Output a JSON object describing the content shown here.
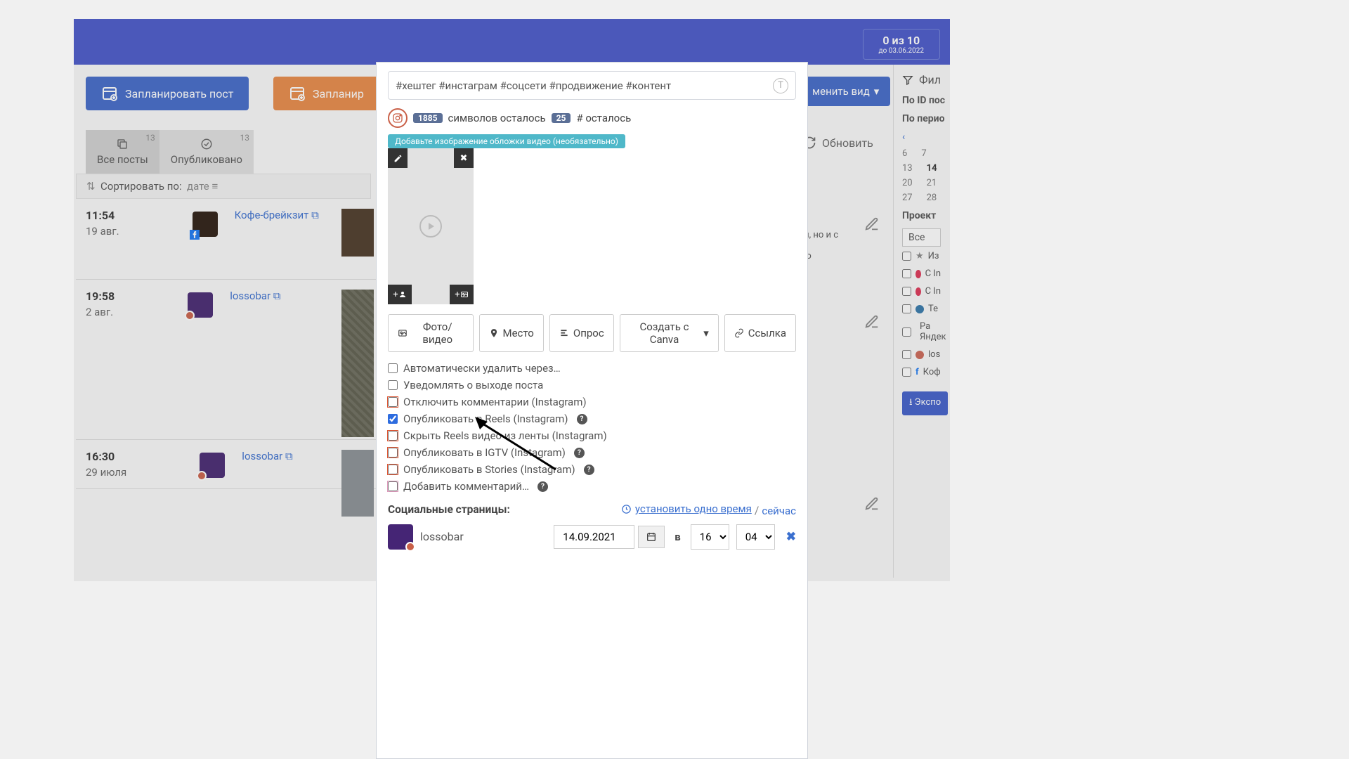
{
  "topbar": {
    "count_text": "0 из 10",
    "until_text": "до 03.06.2022"
  },
  "buttons": {
    "schedule_post": "Запланировать пост",
    "schedule_story": "Запланир",
    "change_view": "менить вид",
    "refresh": "Обновить"
  },
  "tabs": {
    "all_posts": "Все посты",
    "all_count": "13",
    "published": "Опубликовано",
    "published_count": "13"
  },
  "sort": {
    "label": "Сортировать по:",
    "value": "дате"
  },
  "posts": [
    {
      "time": "11:54",
      "date": "19 авг.",
      "title": "Кофе-брейкзит",
      "network": "fb",
      "preview": "м, но и с\n\nго"
    },
    {
      "time": "19:58",
      "date": "2 авг.",
      "title": "lossobar",
      "network": "ig"
    },
    {
      "time": "16:30",
      "date": "29 июля",
      "title": "lossobar",
      "network": "ig"
    }
  ],
  "sidebar": {
    "filter_title": "Фил",
    "by_id": "По ID пос",
    "by_period": "По перио",
    "project": "Проект",
    "all": "Все",
    "items": [
      "Из",
      "С In",
      "С In",
      "Те",
      "Ра\nЯндек",
      "los",
      "Коф"
    ],
    "export": "Экспо",
    "cal": [
      [
        "6",
        "7"
      ],
      [
        "13",
        "14"
      ],
      [
        "20",
        "21"
      ],
      [
        "27",
        "28"
      ]
    ]
  },
  "modal": {
    "composer_text": "#хештег #инстаграм #соцсети #продвижение #контент",
    "chars_remaining_label": "символов осталось",
    "chars_count": "1885",
    "hash_count": "25",
    "hash_label": "# осталось",
    "cover_hint": "Добавьте изображение обложки видео (необязательно)",
    "tool_photo": "Фото/видео",
    "tool_place": "Место",
    "tool_poll": "Опрос",
    "tool_canva": "Создать с Canva",
    "tool_link": "Ссылка",
    "checks": {
      "autodelete": "Автоматически удалить через…",
      "notify": "Уведомлять о выходе поста",
      "disable_comments": "Отключить комментарии (Instagram)",
      "reels": "Опубликовать в Reels (Instagram)",
      "hide_reels_feed": "Скрыть Reels видео из ленты (Instagram)",
      "igtv": "Опубликовать в IGTV (Instagram)",
      "stories": "Опубликовать в Stories (Instagram)",
      "add_comment": "Добавить комментарий…"
    },
    "social_title": "Социальные страницы:",
    "set_time": "установить одно время",
    "now": "сейчас",
    "divider": " / ",
    "social_page_name": "lossobar",
    "date_value": "14.09.2021",
    "at": "в",
    "hour": "16",
    "minute": "04"
  }
}
